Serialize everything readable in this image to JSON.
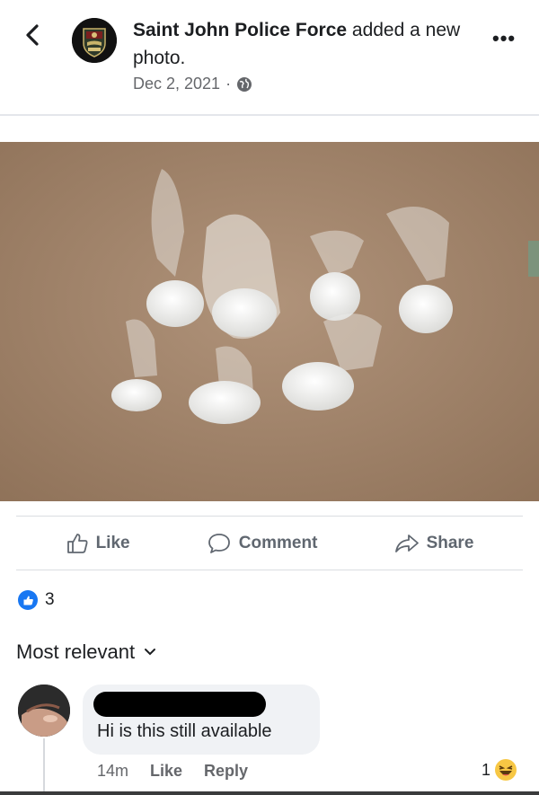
{
  "post": {
    "page_name": "Saint John Police Force",
    "action_text": " added a new photo.",
    "date": "Dec 2, 2021",
    "separator": "·"
  },
  "actions": {
    "like": "Like",
    "comment": "Comment",
    "share": "Share"
  },
  "reactions": {
    "count": "3"
  },
  "sort": {
    "label": "Most relevant"
  },
  "comment": {
    "text": "Hi is this still available",
    "time": "14m",
    "like": "Like",
    "reply": "Reply",
    "reaction_count": "1"
  },
  "colors": {
    "accent": "#1877f2",
    "muted": "#65676b",
    "bubble": "#f0f2f5",
    "photo_background": "#a3866a"
  },
  "icons": [
    "back-chevron-icon",
    "globe-icon",
    "more-dots-icon",
    "like-thumb-icon",
    "comment-bubble-icon",
    "share-arrow-icon",
    "like-badge-icon",
    "chevron-down-icon",
    "haha-emoji-icon"
  ]
}
